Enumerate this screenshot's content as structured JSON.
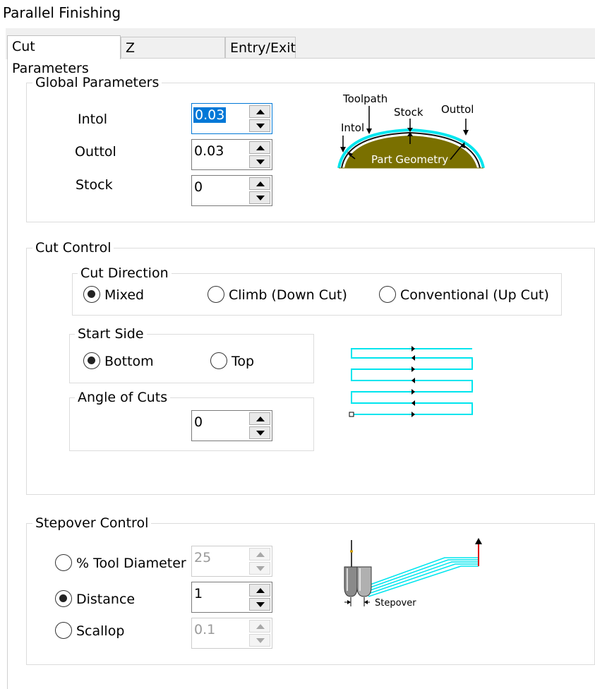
{
  "window": {
    "title": "Parallel Finishing"
  },
  "tabs": [
    {
      "label": "Cut Parameters",
      "active": true
    },
    {
      "label": "Z Containment",
      "active": false
    },
    {
      "label": "Entry/Exit",
      "active": false
    }
  ],
  "global_parameters": {
    "legend": "Global Parameters",
    "intol": {
      "label": "Intol",
      "value": "0.03"
    },
    "outtol": {
      "label": "Outtol",
      "value": "0.03"
    },
    "stock": {
      "label": "Stock",
      "value": "0"
    },
    "diagram": {
      "toolpath": "Toolpath",
      "stock": "Stock",
      "outtol": "Outtol",
      "intol": "Intol",
      "part_geometry": "Part Geometry"
    }
  },
  "cut_control": {
    "legend": "Cut Control",
    "cut_direction": {
      "legend": "Cut Direction",
      "options": [
        {
          "label": "Mixed",
          "selected": true
        },
        {
          "label": "Climb (Down Cut)",
          "selected": false
        },
        {
          "label": "Conventional (Up Cut)",
          "selected": false
        }
      ]
    },
    "start_side": {
      "legend": "Start Side",
      "options": [
        {
          "label": "Bottom",
          "selected": true
        },
        {
          "label": "Top",
          "selected": false
        }
      ]
    },
    "angle_of_cuts": {
      "legend": "Angle of Cuts",
      "value": "0"
    }
  },
  "stepover_control": {
    "legend": "Stepover Control",
    "options": [
      {
        "label": "% Tool Diameter",
        "selected": false,
        "value": "25",
        "enabled": false
      },
      {
        "label": "Distance",
        "selected": true,
        "value": "1",
        "enabled": true
      },
      {
        "label": "Scallop",
        "selected": false,
        "value": "0.1",
        "enabled": false
      }
    ],
    "diagram": {
      "stepover": "Stepover"
    }
  },
  "colors": {
    "toolpath_cyan": "#00e5ee",
    "part_olive": "#7a7000",
    "arrow_red": "#e00000",
    "focus_blue": "#0078d7"
  }
}
